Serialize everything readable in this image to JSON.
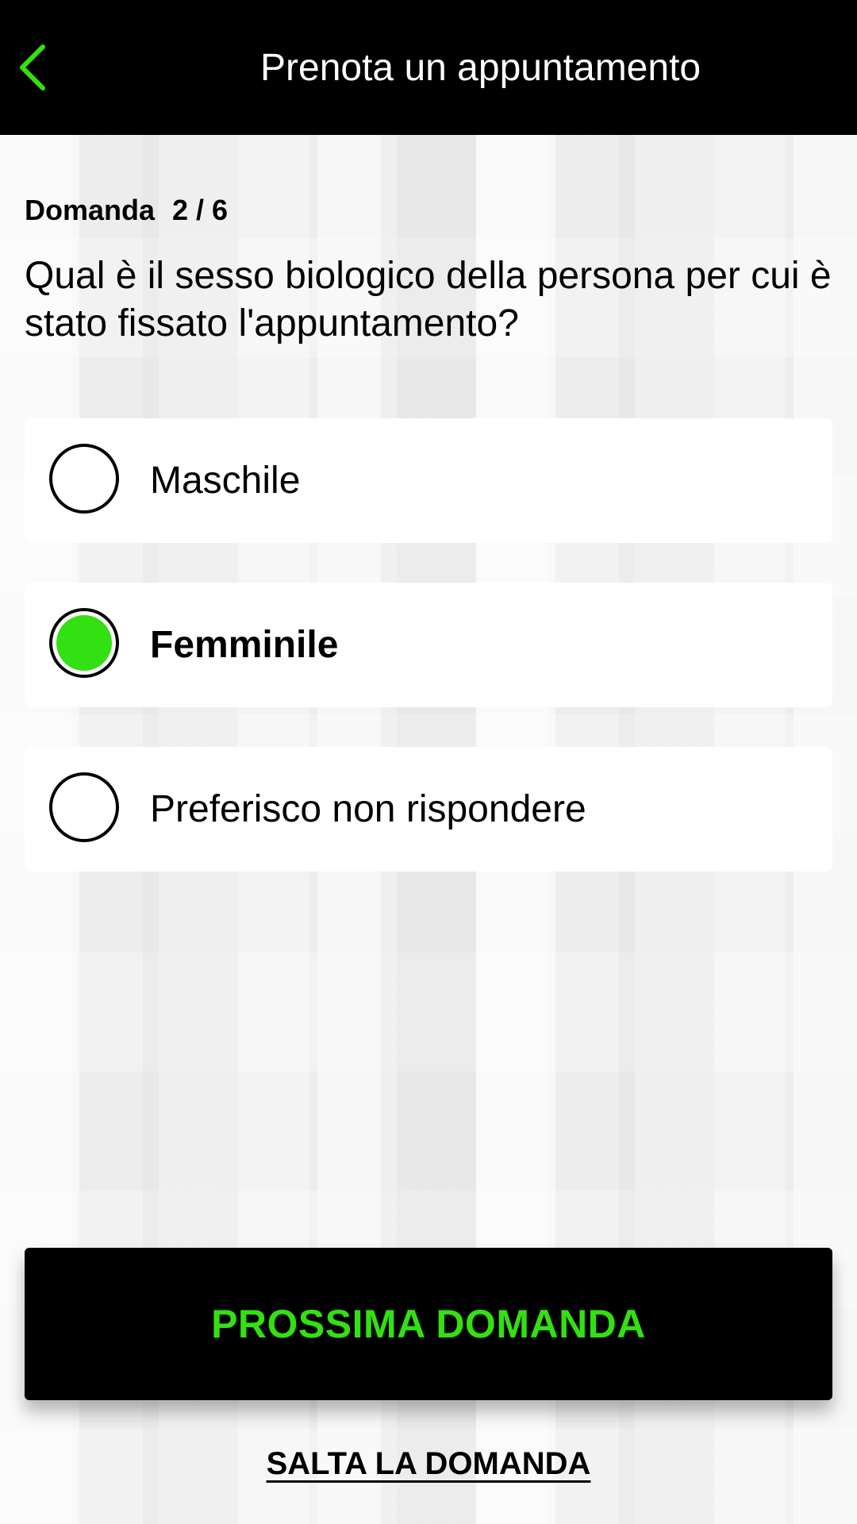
{
  "colors": {
    "accent": "#33e011",
    "header_bg": "#000000",
    "background": "#f2f2f2"
  },
  "header": {
    "title": "Prenota un appuntamento",
    "back_icon": "chevron-left-icon"
  },
  "question": {
    "label": "Domanda",
    "progress": "2 / 6",
    "text": "Qual è il sesso biologico della persona per cui è stato fissato l'appuntamento?"
  },
  "options": [
    {
      "label": "Maschile",
      "selected": false
    },
    {
      "label": "Femminile",
      "selected": true
    },
    {
      "label": "Preferisco non rispondere",
      "selected": false
    }
  ],
  "actions": {
    "next_label": "PROSSIMA DOMANDA",
    "skip_label": "SALTA LA DOMANDA"
  }
}
